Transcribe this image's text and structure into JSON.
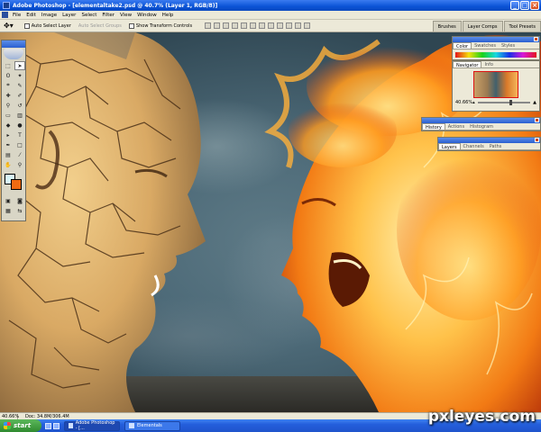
{
  "window": {
    "title": "Adobe Photoshop - [elementaltake2.psd @ 40.7% (Layer 1, RGB/8)]",
    "minimize": "_",
    "maximize": "□",
    "close": "×"
  },
  "menu": [
    "File",
    "Edit",
    "Image",
    "Layer",
    "Select",
    "Filter",
    "View",
    "Window",
    "Help"
  ],
  "options": {
    "auto_select_layer": "Auto Select Layer",
    "auto_select_groups": "Auto Select Groups",
    "show_transform_controls": "Show Transform Controls"
  },
  "palette_well": [
    "Brushes",
    "Layer Comps",
    "Tool Presets"
  ],
  "panels": {
    "color": {
      "tabs": [
        "Color",
        "Swatches",
        "Styles"
      ]
    },
    "navigator": {
      "tabs": [
        "Navigator",
        "Info"
      ],
      "zoom": "40.66%"
    },
    "history": {
      "tabs": [
        "History",
        "Actions",
        "Histogram"
      ]
    },
    "layers": {
      "tabs": [
        "Layers",
        "Channels",
        "Paths"
      ]
    }
  },
  "toolbox": {
    "foreground_color": "#d7f4f8",
    "background_color": "#ef6a12"
  },
  "status": {
    "zoom": "40.66%",
    "doc": "Doc: 34.8M/306.4M"
  },
  "taskbar": {
    "start": "start",
    "tasks": [
      "Adobe Photoshop - [...",
      "Elementals"
    ]
  },
  "watermark": "pxleyes.com"
}
